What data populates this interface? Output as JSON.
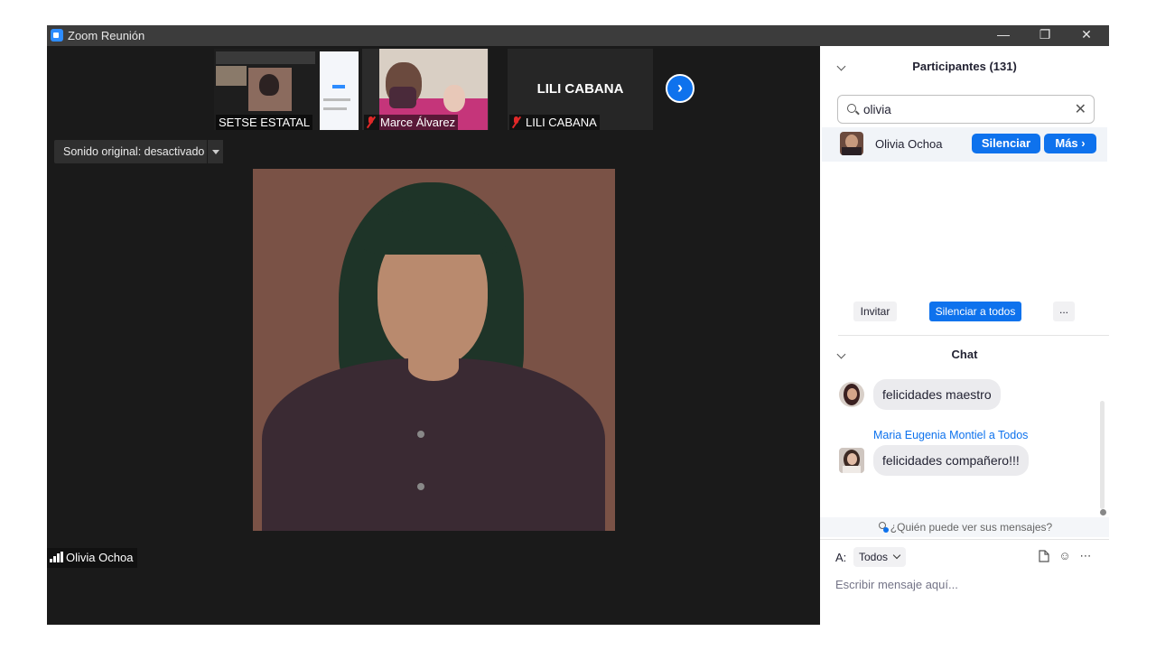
{
  "window": {
    "title": "Zoom Reunión",
    "controls": {
      "minimize": "—",
      "restore": "❐",
      "close": "✕"
    }
  },
  "thumbnails": [
    {
      "label": "SETSE ESTATAL",
      "muted": false
    },
    {
      "label": "Marce Álvarez",
      "muted": true
    },
    {
      "label": "LILI CABANA",
      "muted": true,
      "display_name": "LILI CABANA"
    }
  ],
  "next_page_icon": "chevron-right-icon",
  "sound": {
    "label": "Sonido original: desactivado"
  },
  "active_speaker": {
    "name": "Olivia Ochoa"
  },
  "participants": {
    "title": "Participantes (131)",
    "search_value": "olivia",
    "results": [
      {
        "name": "Olivia Ochoa",
        "mute_label": "Silenciar",
        "more_label": "Más ›"
      }
    ],
    "footer": {
      "invite": "Invitar",
      "mute_all": "Silenciar a todos",
      "more": "..."
    }
  },
  "chat": {
    "title": "Chat",
    "messages": [
      {
        "sender": "",
        "text": "felicidades maestro"
      },
      {
        "sender": "Maria Eugenia Montiel a Todos",
        "text": "felicidades compañero!!!"
      }
    ],
    "visibility_note": "¿Quién puede ver sus mensajes?",
    "to_label": "A:",
    "to_value": "Todos",
    "input_placeholder": "Escribir mensaje aquí..."
  },
  "colors": {
    "accent": "#0e72ed",
    "dark_bg": "#1a1a1a",
    "titlebar": "#3c3c3c",
    "muted_red": "#e02828"
  }
}
